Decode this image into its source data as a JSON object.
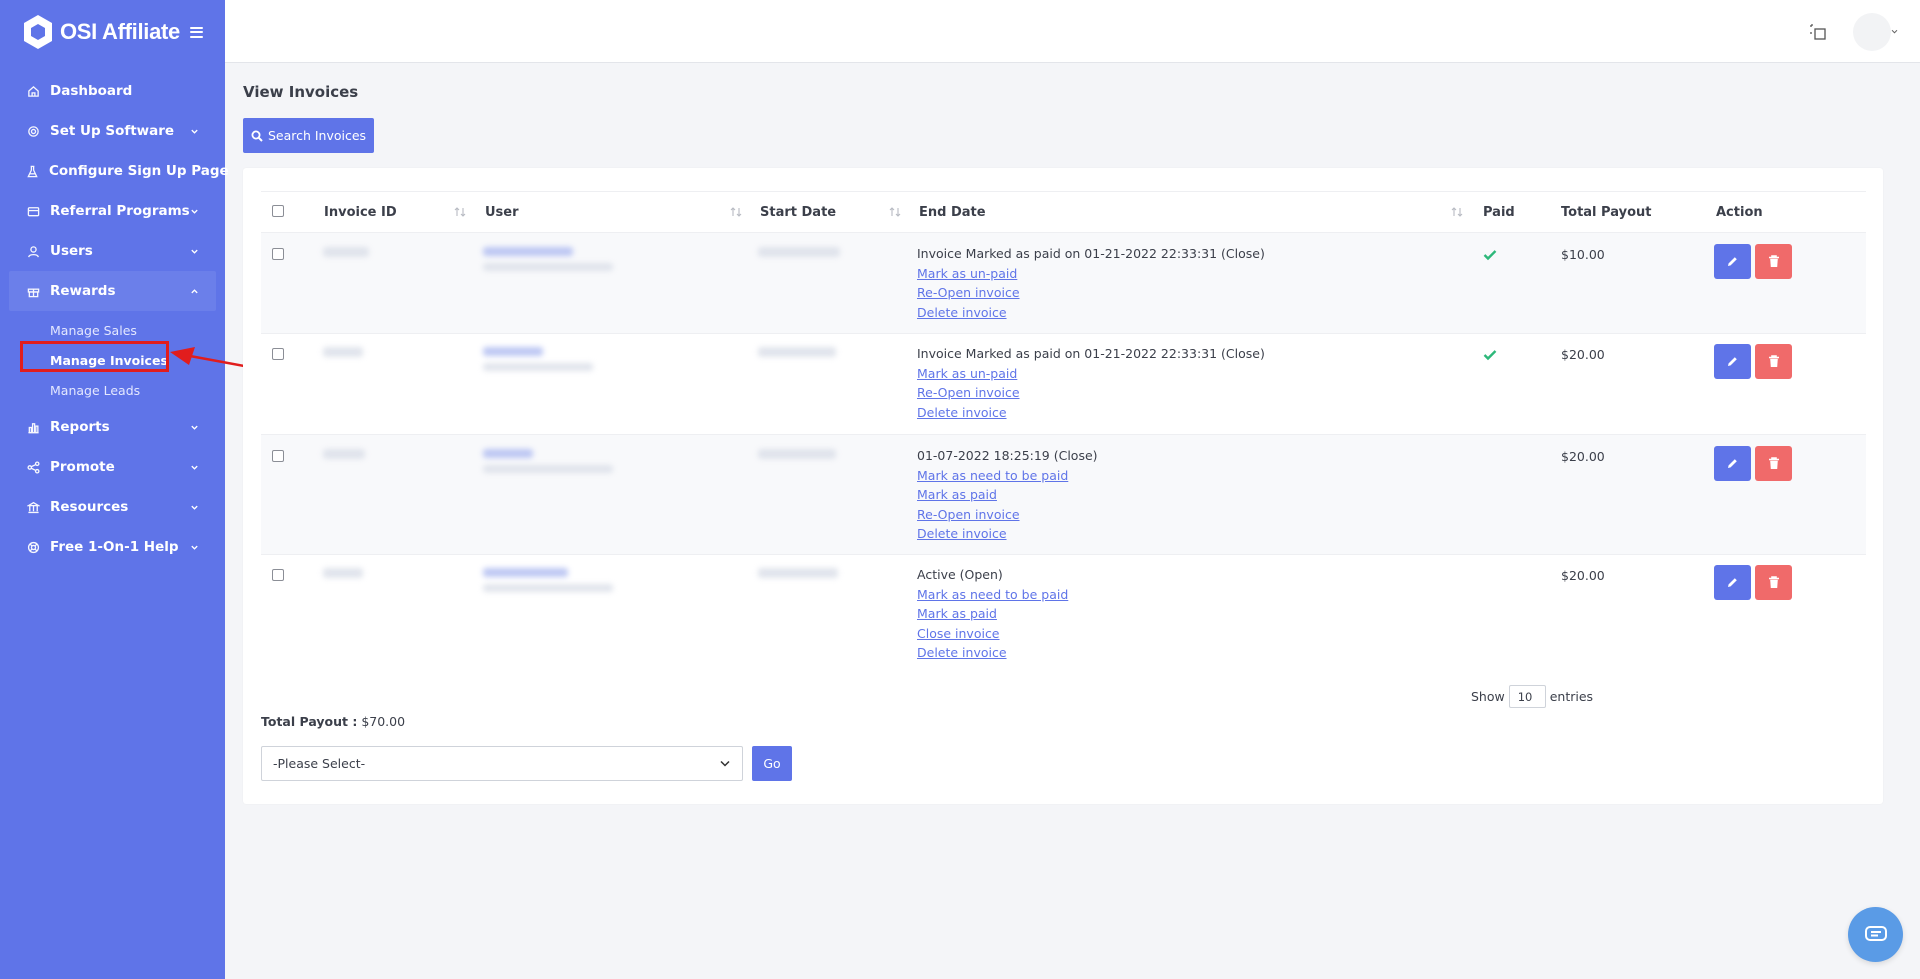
{
  "brand": {
    "name": "OSI Affiliate"
  },
  "sidebar": {
    "items": [
      {
        "label": "Dashboard",
        "icon": "home-icon"
      },
      {
        "label": "Set Up Software",
        "icon": "gear-icon"
      },
      {
        "label": "Configure Sign Up Page",
        "icon": "flask-icon"
      },
      {
        "label": "Referral Programs",
        "icon": "credit-card-icon"
      },
      {
        "label": "Users",
        "icon": "user-icon"
      },
      {
        "label": "Rewards",
        "icon": "gift-icon"
      },
      {
        "label": "Reports",
        "icon": "bar-chart-icon"
      },
      {
        "label": "Promote",
        "icon": "share-icon"
      },
      {
        "label": "Resources",
        "icon": "bank-icon"
      },
      {
        "label": "Free 1-On-1 Help",
        "icon": "lifebuoy-icon"
      }
    ],
    "rewards_sub": [
      "Manage Sales",
      "Manage Invoices",
      "Manage Leads"
    ]
  },
  "main": {
    "title": "View Invoices",
    "search_button": "Search Invoices",
    "table": {
      "headers": [
        "Invoice ID",
        "User",
        "Start Date",
        "End Date",
        "Paid",
        "Total Payout",
        "Action"
      ],
      "rows": [
        {
          "status": "Invoice Marked as paid on 01-21-2022 22:33:31 (Close)",
          "links": [
            "Mark as un-paid",
            "Re-Open invoice",
            "Delete invoice"
          ],
          "paid": true,
          "payout": "$10.00"
        },
        {
          "status": "Invoice Marked as paid on 01-21-2022 22:33:31 (Close)",
          "links": [
            "Mark as un-paid",
            "Re-Open invoice",
            "Delete invoice"
          ],
          "paid": true,
          "payout": "$20.00"
        },
        {
          "status": "01-07-2022 18:25:19 (Close)",
          "links": [
            "Mark as need to be paid",
            "Mark as paid",
            "Re-Open invoice",
            "Delete invoice"
          ],
          "paid": false,
          "payout": "$20.00"
        },
        {
          "status": "Active (Open)",
          "links": [
            "Mark as need to be paid",
            "Mark as paid",
            "Close invoice",
            "Delete invoice"
          ],
          "paid": false,
          "payout": "$20.00"
        }
      ]
    },
    "show_label": "Show",
    "entries_value": "10",
    "entries_label": "entries",
    "total_label": "Total Payout :",
    "total_value": "$70.00",
    "select_value": "-Please Select-",
    "go_button": "Go"
  },
  "colors": {
    "primary": "#5f74e8",
    "danger": "#f06a6a",
    "success": "#2eb87a",
    "highlight": "#e11d1d"
  }
}
